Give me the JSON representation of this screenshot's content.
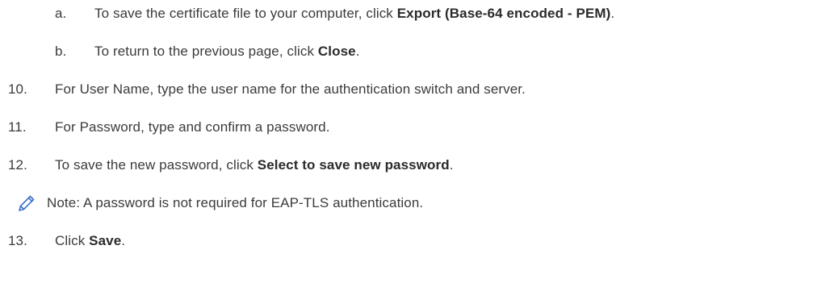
{
  "sub_steps": [
    {
      "marker": "a.",
      "before": "To save the certificate file to your computer, click ",
      "bold": "Export (Base-64 encoded - PEM)",
      "after": "."
    },
    {
      "marker": "b.",
      "before": "To return to the previous page, click ",
      "bold": "Close",
      "after": "."
    }
  ],
  "steps": [
    {
      "marker": "10.",
      "before": "For User Name, type the user name for the authentication switch and server.",
      "bold": "",
      "after": ""
    },
    {
      "marker": "11.",
      "before": "For Password, type and confirm a password.",
      "bold": "",
      "after": ""
    },
    {
      "marker": "12.",
      "before": "To save the new password, click ",
      "bold": "Select to save new password",
      "after": "."
    },
    {
      "marker": "13.",
      "before": "Click ",
      "bold": "Save",
      "after": "."
    }
  ],
  "note": {
    "icon": "pencil-icon",
    "text": "Note: A password is not required for EAP-TLS authentication."
  },
  "colors": {
    "text": "#3b3b3b",
    "note_icon": "#3d72c9"
  }
}
